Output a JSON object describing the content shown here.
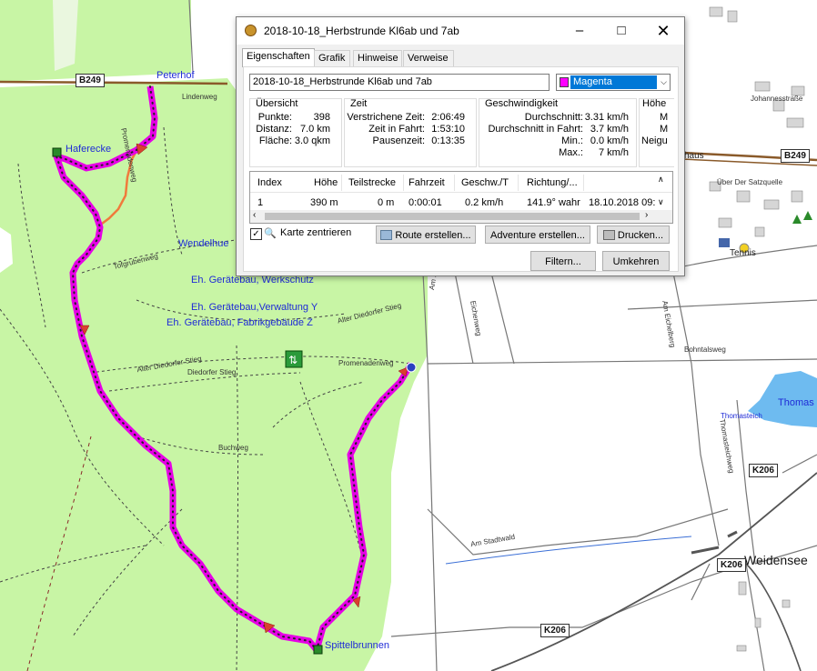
{
  "map": {
    "labels": {
      "peterhof": "Peterhof",
      "haferecke": "Haferecke",
      "wendelhue": "Wendelhue",
      "geraetebau_werkschutz": "Eh. Gerätebau, Werkschutz",
      "geraetebau_verwaltung": "Eh. Gerätebau,Verwaltung Y",
      "geraetebau_fabrik": "Eh. Gerätebau, Fabrikgebäude Z",
      "spittelbrunnen": "Spittelbrunnen",
      "tennis": "Tennis",
      "thomas": "Thomas",
      "thomasteich": "Thomasteich",
      "weidensee": "Weidensee",
      "haus": "haus",
      "lindenweg": "Lindenweg",
      "promenadenweg": "Promenadenweg",
      "promenadenweg2": "Promenadenweg",
      "tofgrubenweg": "Tofgrubenweg",
      "alter_diedorfer_stieg": "Alter Diedorfer Stieg",
      "alter_diedorfer_stieg2": "Alter Diedorfer Stieg",
      "diedorfer_stieg": "Diedorfer Stieg",
      "buchweg": "Buchweg",
      "am_steinwald": "Am Steinwald",
      "am_stadtwald": "Am Stadtwald",
      "eichenweg": "Eichenweg",
      "am_eichelberg": "Am Eichelberg",
      "bohntalsweg": "Bohntalsweg",
      "thomasteichweg": "Thomasteichweg",
      "ueber_der_satzquelle": "Über Der Satzquelle",
      "johannesstrasse": "Johannesstraße"
    },
    "shields": {
      "b249_left": "B249",
      "b249_right": "B249",
      "k206_right": "K206",
      "k206_mid": "K206",
      "k206_bottom": "K206"
    },
    "colors": {
      "forest": "#c8f5a5",
      "track": "#e600e6",
      "water": "#6ebbf0",
      "road_main": "#8a5a2a"
    }
  },
  "dialog": {
    "title": "2018-10-18_Herbstrunde Kl6ab und 7ab",
    "tabs": [
      "Eigenschaften",
      "Grafik",
      "Hinweise",
      "Verweise"
    ],
    "name_value": "2018-10-18_Herbstrunde Kl6ab und 7ab",
    "color_select": "Magenta",
    "color_swatch": "#ff00ff",
    "overview": {
      "title": "Übersicht",
      "rows": [
        {
          "k": "Punkte:",
          "v": "398"
        },
        {
          "k": "Distanz:",
          "v": "7.0 km"
        },
        {
          "k": "Fläche:",
          "v": "3.0 qkm"
        }
      ]
    },
    "time": {
      "title": "Zeit",
      "rows": [
        {
          "k": "Verstrichene Zeit:",
          "v": "2:06:49"
        },
        {
          "k": "Zeit in Fahrt:",
          "v": "1:53:10"
        },
        {
          "k": "Pausenzeit:",
          "v": "0:13:35"
        }
      ]
    },
    "speed": {
      "title": "Geschwindigkeit",
      "rows": [
        {
          "k": "Durchschnitt:",
          "v": "3.31 km/h"
        },
        {
          "k": "Durchschnitt in Fahrt:",
          "v": "3.7 km/h"
        },
        {
          "k": "Min.:",
          "v": "0.0 km/h"
        },
        {
          "k": "Max.:",
          "v": "7 km/h"
        }
      ]
    },
    "height": {
      "title": "Höhe",
      "rows": [
        "M",
        "M",
        "Neigu"
      ]
    },
    "table": {
      "headers": [
        "Index",
        "Höhe",
        "Teilstrecke",
        "Fahrzeit",
        "Geschw./T",
        "Richtung/...",
        ""
      ],
      "row": [
        "1",
        "390 m",
        "0 m",
        "0:00:01",
        "0.2 km/h",
        "141.9° wahr",
        "18.10.2018 09:"
      ]
    },
    "center_checkbox": "Karte zentrieren",
    "buttons": {
      "route": "Route erstellen...",
      "adventure": "Adventure erstellen...",
      "print": "Drucken...",
      "filter": "Filtern...",
      "reverse": "Umkehren"
    }
  }
}
